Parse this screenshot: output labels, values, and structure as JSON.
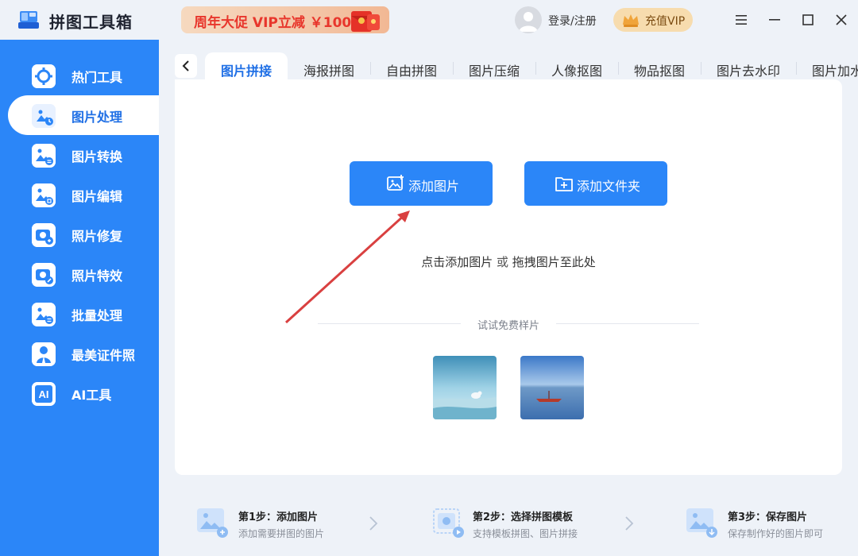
{
  "app": {
    "title": "拼图工具箱"
  },
  "promo": {
    "text": "周年大促 VIP立减 ￥100"
  },
  "header": {
    "login_label": "登录/注册",
    "vip_label": "充值VIP"
  },
  "colors": {
    "accent": "#2b86f8",
    "active_text": "#1f6fe5",
    "promo_red": "#e8362c"
  },
  "sidebar": {
    "items": [
      {
        "label": "热门工具",
        "icon": "hot-tools-icon"
      },
      {
        "label": "图片处理",
        "icon": "image-process-icon",
        "active": true
      },
      {
        "label": "图片转换",
        "icon": "image-convert-icon"
      },
      {
        "label": "图片编辑",
        "icon": "image-edit-icon"
      },
      {
        "label": "照片修复",
        "icon": "photo-repair-icon"
      },
      {
        "label": "照片特效",
        "icon": "photo-effects-icon"
      },
      {
        "label": "批量处理",
        "icon": "batch-process-icon"
      },
      {
        "label": "最美证件照",
        "icon": "id-photo-icon"
      },
      {
        "label": "AI工具",
        "icon": "ai-tools-icon"
      }
    ]
  },
  "tabs": [
    {
      "label": "图片拼接",
      "active": true
    },
    {
      "label": "海报拼图"
    },
    {
      "label": "自由拼图"
    },
    {
      "label": "图片压缩"
    },
    {
      "label": "人像抠图"
    },
    {
      "label": "物品抠图"
    },
    {
      "label": "图片去水印"
    },
    {
      "label": "图片加水"
    }
  ],
  "main": {
    "add_image_label": "添加图片",
    "add_folder_label": "添加文件夹",
    "hint_click": "点击添加图片",
    "hint_or": "或",
    "hint_drag": "拖拽图片至此处",
    "sample_label": "试试免费样片"
  },
  "steps": [
    {
      "title": "第1步：添加图片",
      "desc": "添加需要拼图的图片"
    },
    {
      "title": "第2步：选择拼图模板",
      "desc": "支持模板拼图、图片拼接"
    },
    {
      "title": "第3步：保存图片",
      "desc": "保存制作好的图片即可"
    }
  ]
}
